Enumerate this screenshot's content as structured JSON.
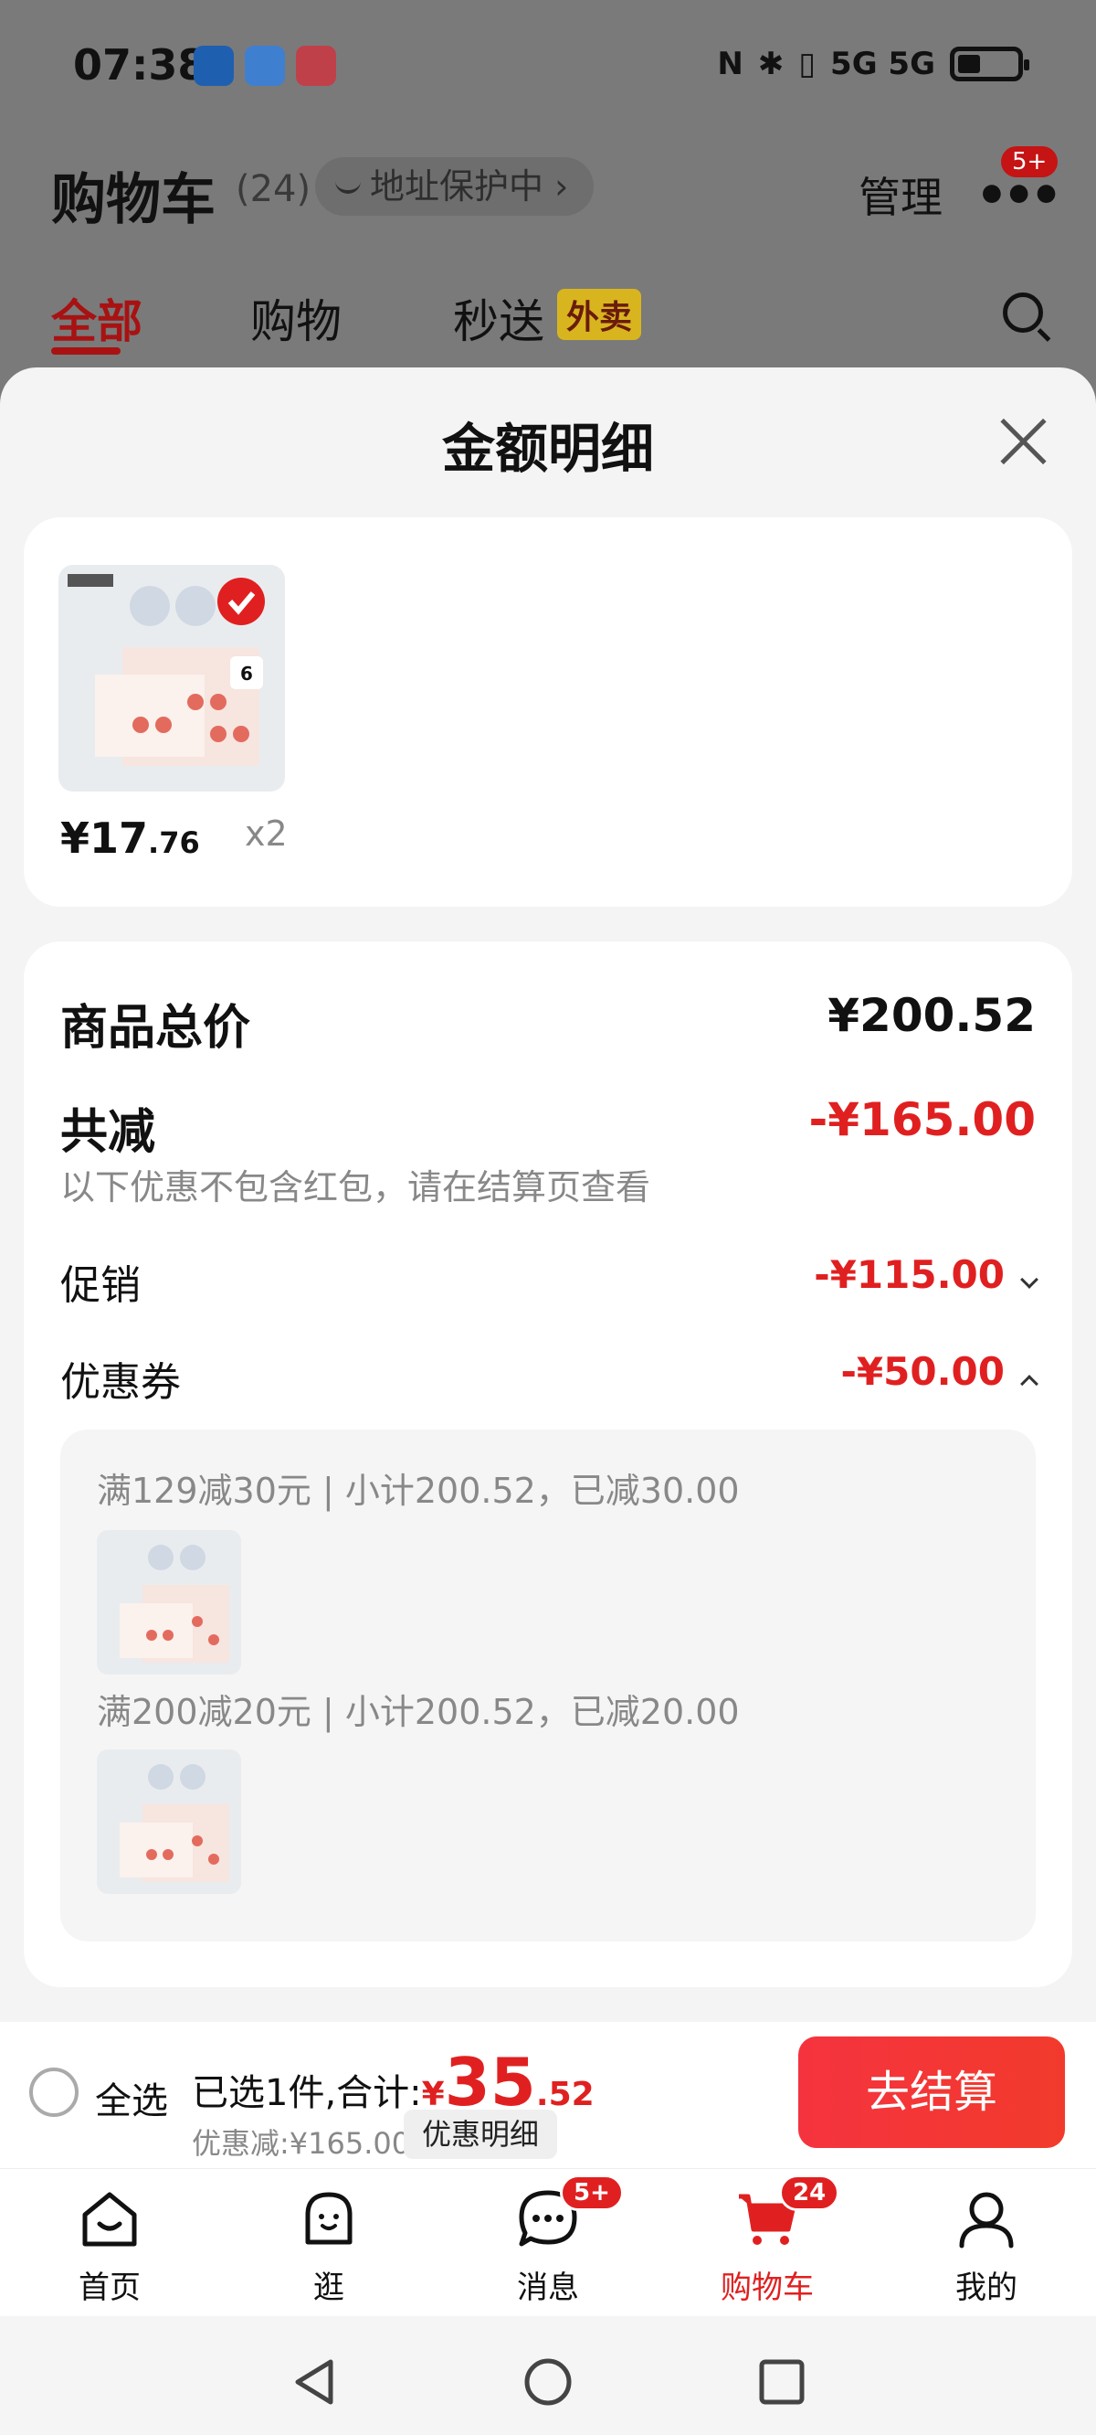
{
  "status_bar": {
    "time": "07:38",
    "network": "5G 5G"
  },
  "header": {
    "title": "购物车",
    "count": "(24)",
    "address_chip": "地址保护中",
    "manage": "管理",
    "more_badge": "5+"
  },
  "tabs": [
    {
      "label": "全部"
    },
    {
      "label": "购物"
    },
    {
      "label": "秒送"
    }
  ],
  "tab_tag": "外卖",
  "sheet": {
    "title": "金额明细",
    "product": {
      "price_int": "¥17",
      "price_dec": ".76",
      "quantity": "x2"
    },
    "summary": {
      "total_label": "商品总价",
      "total_value": "¥200.52",
      "discount_label": "共减",
      "discount_value": "-¥165.00",
      "discount_note": "以下优惠不包含红包，请在结算页查看",
      "promo_label": "促销",
      "promo_value": "-¥115.00",
      "coupon_label": "优惠券",
      "coupon_value": "-¥50.00"
    },
    "coupons": [
      {
        "text": "满129减30元 | 小计200.52，已减30.00"
      },
      {
        "text": "满200减20元 | 小计200.52，已减20.00"
      }
    ]
  },
  "checkout": {
    "select_all": "全选",
    "selected_prefix": "已选1件,合计:",
    "currency": "¥",
    "total_int": "35",
    "total_dec": ".52",
    "discount_text": "优惠减:¥165.00",
    "detail_chip": "优惠明细",
    "button": "去结算"
  },
  "bottom_nav": {
    "items": [
      {
        "label": "首页"
      },
      {
        "label": "逛"
      },
      {
        "label": "消息",
        "badge": "5+"
      },
      {
        "label": "购物车",
        "badge": "24"
      },
      {
        "label": "我的"
      }
    ]
  },
  "colors": {
    "accent": "#e02020",
    "checkout_button": "#f5333f"
  }
}
